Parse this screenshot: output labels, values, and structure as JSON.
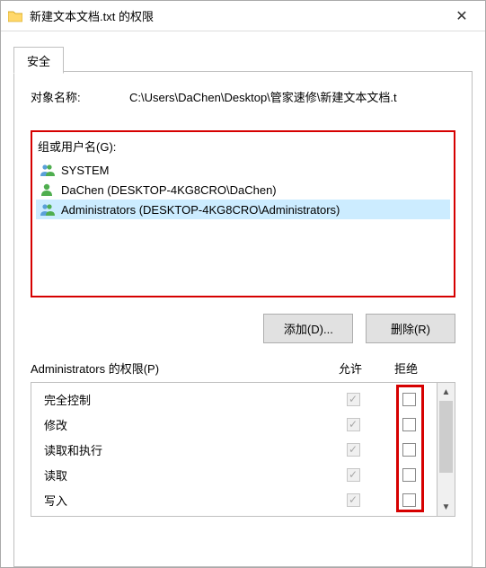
{
  "title": "新建文本文档.txt 的权限",
  "tabs": {
    "security": "安全"
  },
  "object": {
    "label": "对象名称:",
    "path": "C:\\Users\\DaChen\\Desktop\\管家速修\\新建文本文档.t"
  },
  "groups": {
    "label": "组或用户名(G):",
    "items": [
      {
        "icon": "group",
        "text": "SYSTEM",
        "selected": false
      },
      {
        "icon": "user",
        "text": "DaChen (DESKTOP-4KG8CRO\\DaChen)",
        "selected": false
      },
      {
        "icon": "group",
        "text": "Administrators (DESKTOP-4KG8CRO\\Administrators)",
        "selected": true
      }
    ]
  },
  "buttons": {
    "add": "添加(D)...",
    "remove": "删除(R)"
  },
  "permissions": {
    "title": "Administrators 的权限(P)",
    "allow_label": "允许",
    "deny_label": "拒绝",
    "rows": [
      {
        "name": "完全控制",
        "allow": true,
        "allow_disabled": true,
        "deny": false
      },
      {
        "name": "修改",
        "allow": true,
        "allow_disabled": true,
        "deny": false
      },
      {
        "name": "读取和执行",
        "allow": true,
        "allow_disabled": true,
        "deny": false
      },
      {
        "name": "读取",
        "allow": true,
        "allow_disabled": true,
        "deny": false
      },
      {
        "name": "写入",
        "allow": true,
        "allow_disabled": true,
        "deny": false
      }
    ]
  }
}
